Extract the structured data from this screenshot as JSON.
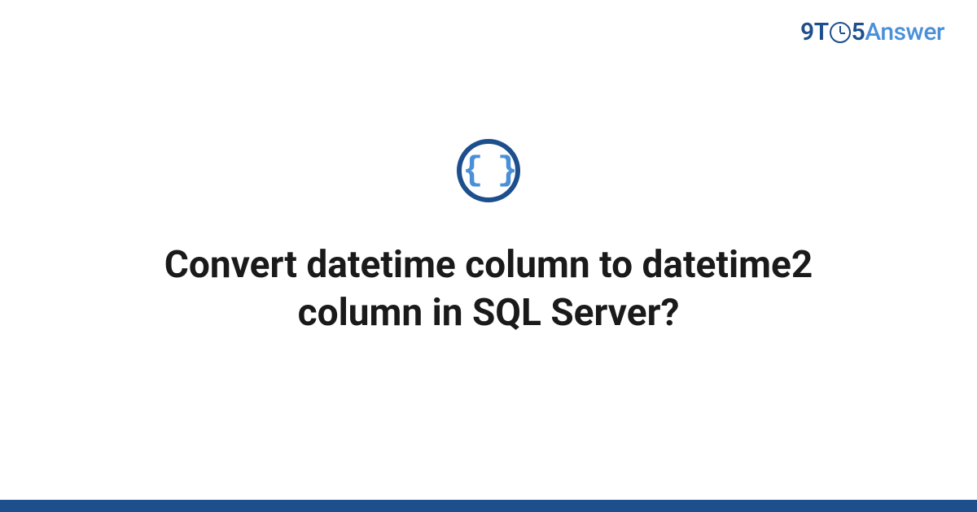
{
  "logo": {
    "nine": "9",
    "t": "T",
    "five": "5",
    "answer": "Answer"
  },
  "category_icon": {
    "symbol": "{ }"
  },
  "title": "Convert datetime column to datetime2 column in SQL Server?"
}
